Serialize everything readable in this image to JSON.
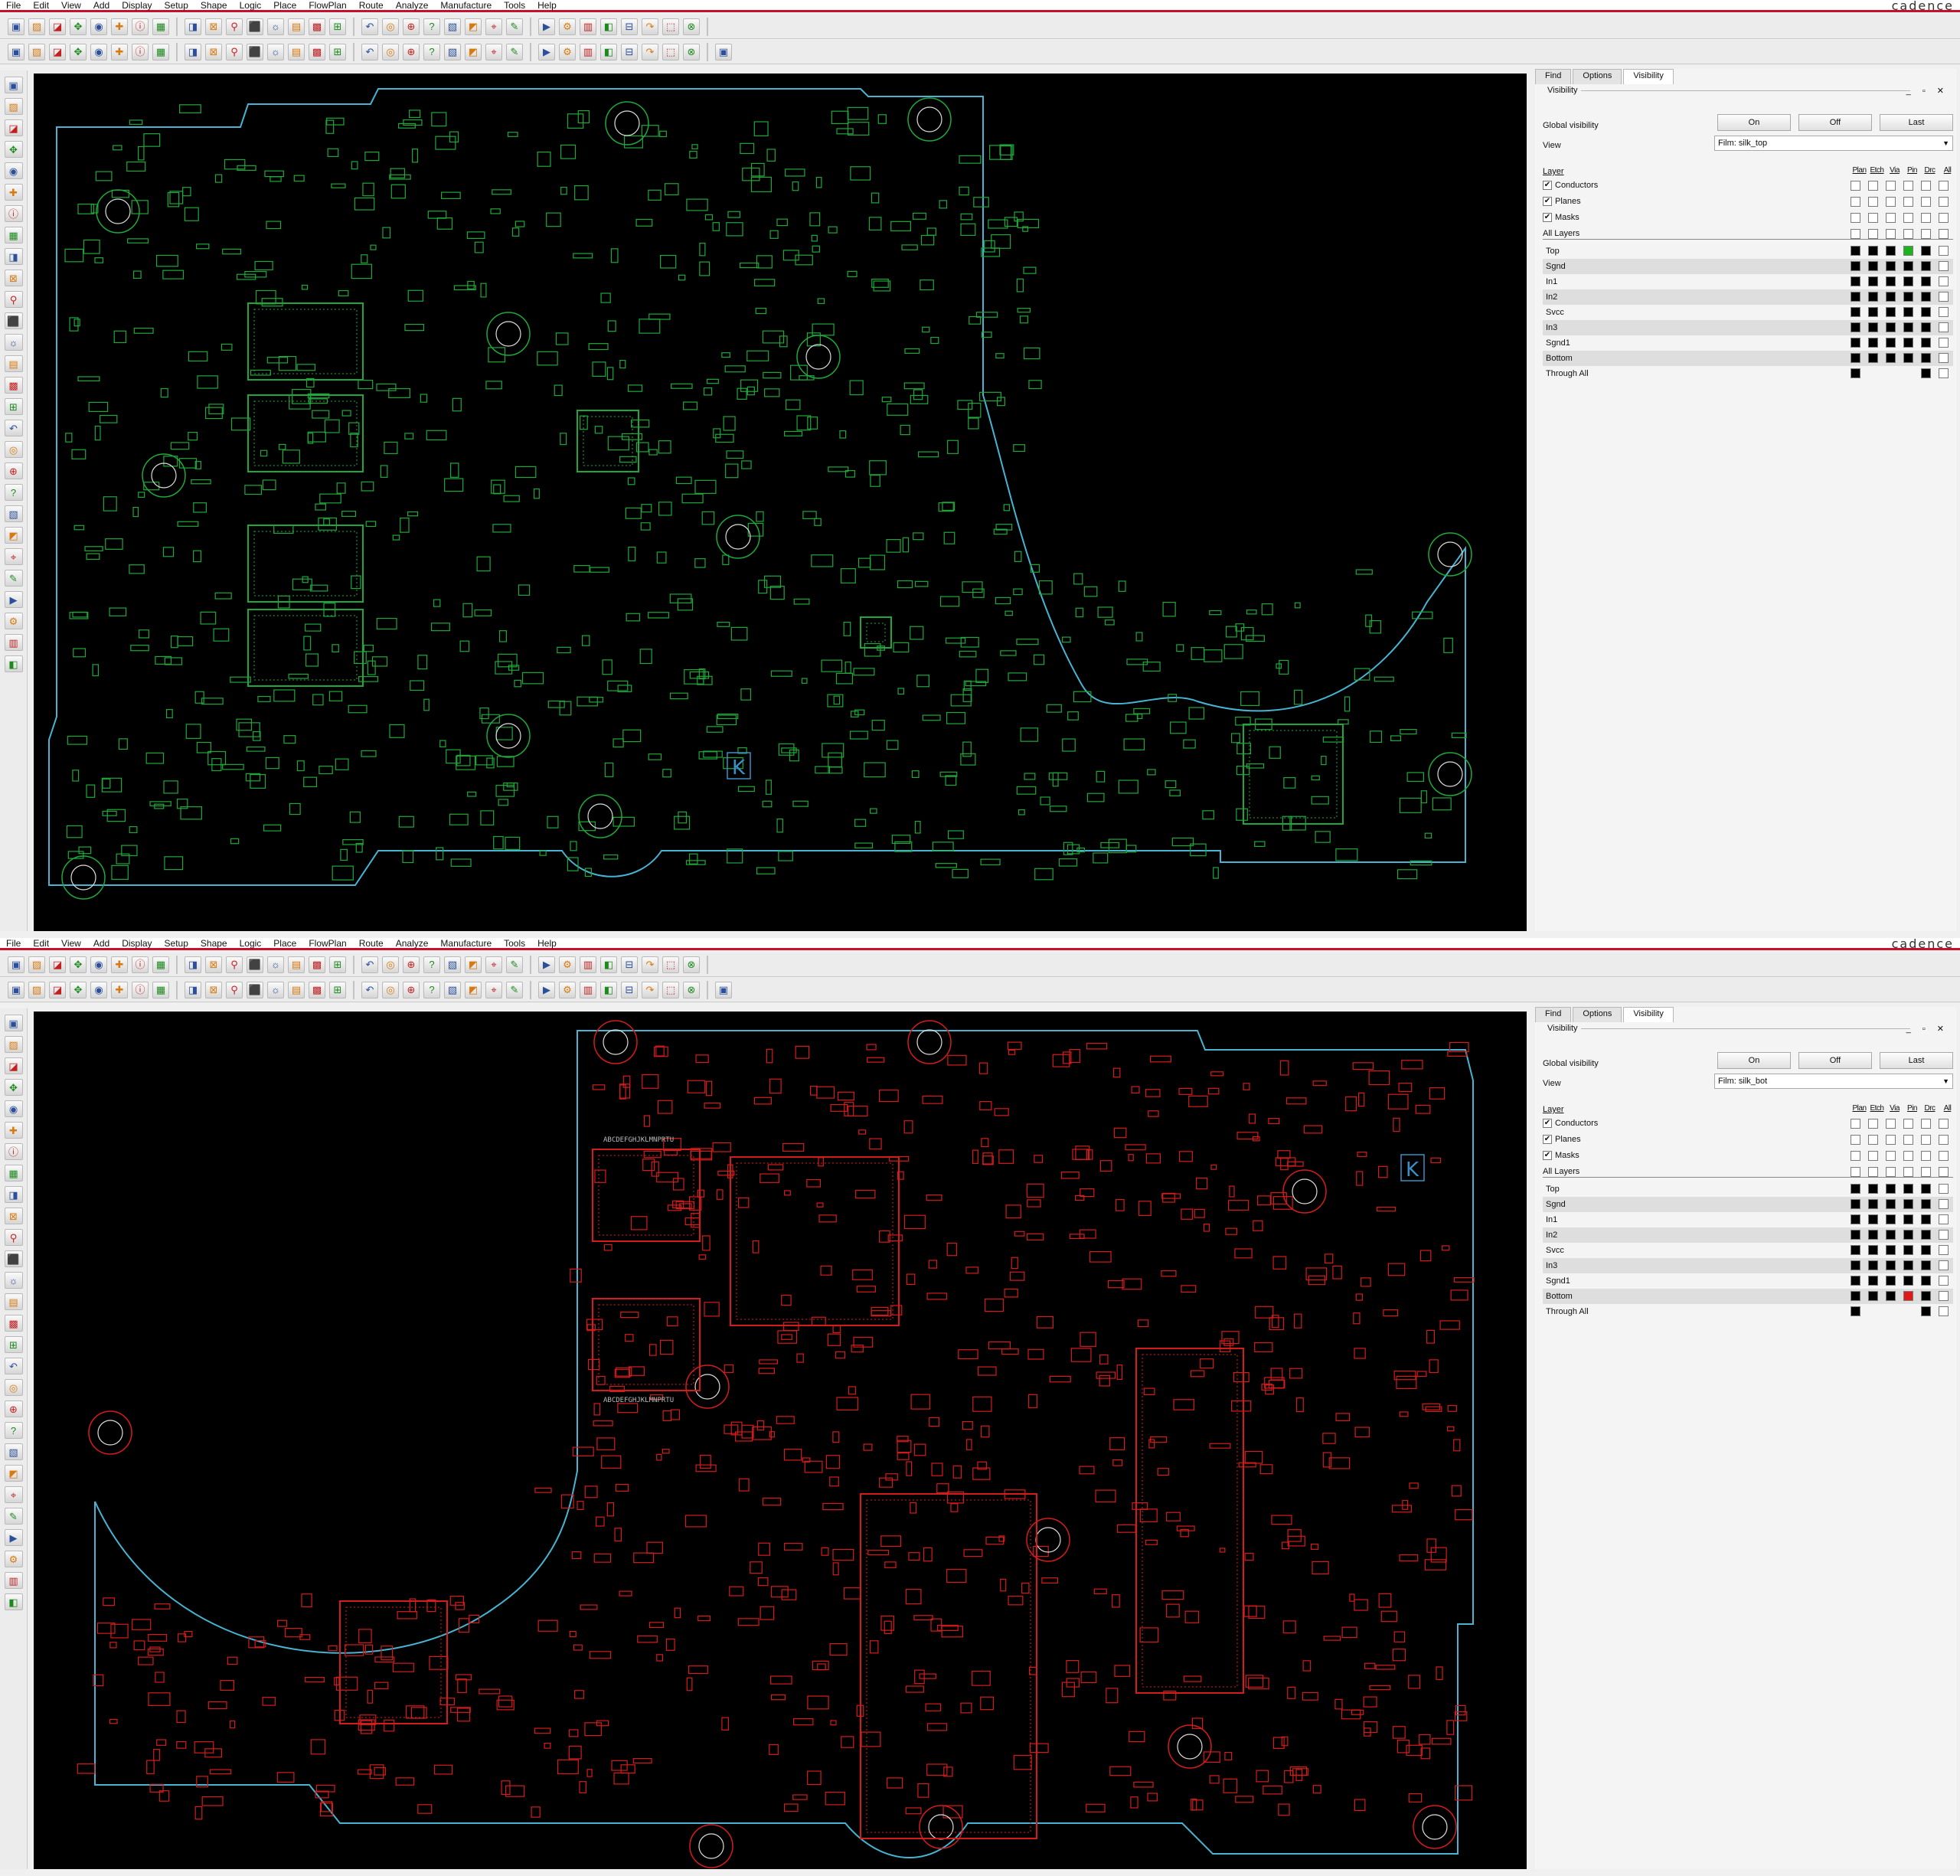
{
  "menu": [
    "File",
    "Edit",
    "View",
    "Add",
    "Display",
    "Setup",
    "Shape",
    "Logic",
    "Place",
    "FlowPlan",
    "Route",
    "Analyze",
    "Manufacture",
    "Tools",
    "Help"
  ],
  "brand": "cadence",
  "toolbar_row1_icons": [
    "new-file-icon",
    "open-file-icon",
    "save-icon",
    "move-icon",
    "copy-icon",
    "delete-icon",
    "undo-icon",
    "redo-icon",
    "fix-icon",
    "pin-icon",
    "grid-icon",
    "zoom-fit-icon",
    "zoom-in-icon",
    "zoom-out-icon",
    "zoom-world-icon",
    "zoom-prev-icon",
    "redraw-icon",
    "3d-view-icon",
    "layer-icon",
    "color-icon",
    "shadow-icon",
    "find-icon",
    "dfa-icon",
    "measure-icon",
    "highlight-icon",
    "dehighlight-icon",
    "assign-color-icon",
    "property-icon",
    "report-icon",
    "drc-icon",
    "info-icon",
    "help-icon"
  ],
  "toolbar_row2_icons": [
    "layer-vis-1-icon",
    "layer-vis-2-icon",
    "layer-vis-3-icon",
    "layer-vis-4-icon",
    "layer-vis-5-icon",
    "layer-vis-6-icon",
    "layer-vis-7-icon",
    "place-manual-icon",
    "place-quick-icon",
    "rect-icon",
    "circle-icon",
    "shape-icon",
    "polygon-icon",
    "frectangle-icon",
    "void-icon",
    "text-icon",
    "net-icon",
    "connect-icon",
    "slide-icon",
    "spread-icon",
    "fanout-icon",
    "via-icon",
    "custom-smooth-icon",
    "delay-tune-icon",
    "gloss-icon",
    "cline-icon",
    "diffpair-icon",
    "xnet-icon",
    "bus-icon",
    "constraint-icon",
    "manufacture-icon",
    "artwork-icon",
    "help2-icon"
  ],
  "left_tools": [
    "route-add-icon",
    "route-slide-icon",
    "route-delay-icon",
    "route-vias-icon",
    "route-fanout-icon",
    "place-icon",
    "move-icon",
    "swap-icon",
    "mirror-icon",
    "rotate-icon",
    "shape-add-icon",
    "shape-edit-icon",
    "shape-void-icon",
    "line-icon",
    "arc-icon",
    "circle-icon",
    "text-add-icon",
    "text-edit-icon",
    "dimension-icon",
    "drill-icon",
    "padstack-icon",
    "symbol-icon",
    "net-icon",
    "property-icon",
    "group-icon",
    "lock-icon",
    "unlock-icon",
    "snap-icon"
  ],
  "screens": [
    {
      "id": "top",
      "panel": {
        "tabs": [
          "Find",
          "Options",
          "Visibility"
        ],
        "active_tab": "Visibility",
        "title": "Visibility",
        "title_controls": "_ ▫ ✕",
        "global_visibility_label": "Global visibility",
        "buttons": [
          "On",
          "Off",
          "Last"
        ],
        "view_label": "View",
        "view_value": "Film: silk_top",
        "layer_header": "Layer",
        "columns": [
          "Plan",
          "Etch",
          "Via",
          "Pin",
          "Drc",
          "All"
        ],
        "groups": [
          {
            "label": "Conductors",
            "checked": true
          },
          {
            "label": "Planes",
            "checked": true
          },
          {
            "label": "Masks",
            "checked": true
          },
          {
            "label": "All Layers",
            "checked": false
          }
        ],
        "layers": [
          {
            "name": "Top",
            "boxes": [
              "k",
              "k",
              "k",
              "gr",
              "k",
              "w"
            ]
          },
          {
            "name": "Sgnd",
            "boxes": [
              "k",
              "k",
              "k",
              "k",
              "k",
              "w"
            ]
          },
          {
            "name": "In1",
            "boxes": [
              "k",
              "k",
              "k",
              "k",
              "k",
              "w"
            ]
          },
          {
            "name": "In2",
            "boxes": [
              "k",
              "k",
              "k",
              "k",
              "k",
              "w"
            ]
          },
          {
            "name": "Svcc",
            "boxes": [
              "k",
              "k",
              "k",
              "k",
              "k",
              "w"
            ]
          },
          {
            "name": "In3",
            "boxes": [
              "k",
              "k",
              "k",
              "k",
              "k",
              "w"
            ]
          },
          {
            "name": "Sgnd1",
            "boxes": [
              "k",
              "k",
              "k",
              "k",
              "k",
              "w"
            ]
          },
          {
            "name": "Bottom",
            "boxes": [
              "k",
              "k",
              "k",
              "k",
              "k",
              "w"
            ]
          },
          {
            "name": "Through All",
            "boxes": [
              "k",
              "none",
              "none",
              "none",
              "k",
              "w"
            ]
          }
        ]
      },
      "board": {
        "outline_color": "#46b4d2",
        "component_color": "#1fa83a",
        "silk_text": "K"
      }
    },
    {
      "id": "bottom",
      "panel": {
        "tabs": [
          "Find",
          "Options",
          "Visibility"
        ],
        "active_tab": "Visibility",
        "title": "Visibility",
        "title_controls": "_ ▫ ✕",
        "global_visibility_label": "Global visibility",
        "buttons": [
          "On",
          "Off",
          "Last"
        ],
        "view_label": "View",
        "view_value": "Film: silk_bot",
        "layer_header": "Layer",
        "columns": [
          "Plan",
          "Etch",
          "Via",
          "Pin",
          "Drc",
          "All"
        ],
        "groups": [
          {
            "label": "Conductors",
            "checked": true
          },
          {
            "label": "Planes",
            "checked": true
          },
          {
            "label": "Masks",
            "checked": true
          },
          {
            "label": "All Layers",
            "checked": false
          }
        ],
        "layers": [
          {
            "name": "Top",
            "boxes": [
              "k",
              "k",
              "k",
              "k",
              "k",
              "w"
            ]
          },
          {
            "name": "Sgnd",
            "boxes": [
              "k",
              "k",
              "k",
              "k",
              "k",
              "w"
            ]
          },
          {
            "name": "In1",
            "boxes": [
              "k",
              "k",
              "k",
              "k",
              "k",
              "w"
            ]
          },
          {
            "name": "In2",
            "boxes": [
              "k",
              "k",
              "k",
              "k",
              "k",
              "w"
            ]
          },
          {
            "name": "Svcc",
            "boxes": [
              "k",
              "k",
              "k",
              "k",
              "k",
              "w"
            ]
          },
          {
            "name": "In3",
            "boxes": [
              "k",
              "k",
              "k",
              "k",
              "k",
              "w"
            ]
          },
          {
            "name": "Sgnd1",
            "boxes": [
              "k",
              "k",
              "k",
              "k",
              "k",
              "w"
            ]
          },
          {
            "name": "Bottom",
            "boxes": [
              "k",
              "k",
              "k",
              "rd",
              "k",
              "w"
            ]
          },
          {
            "name": "Through All",
            "boxes": [
              "k",
              "none",
              "none",
              "none",
              "k",
              "w"
            ]
          }
        ]
      },
      "board": {
        "outline_color": "#46b4d2",
        "component_color": "#d41c1c",
        "silk_text": "K",
        "chip_label_1": "ABCDEFGHJKLMNPRTU",
        "chip_label_2": "ABCDEFGHJKLMNPRTU"
      }
    }
  ]
}
